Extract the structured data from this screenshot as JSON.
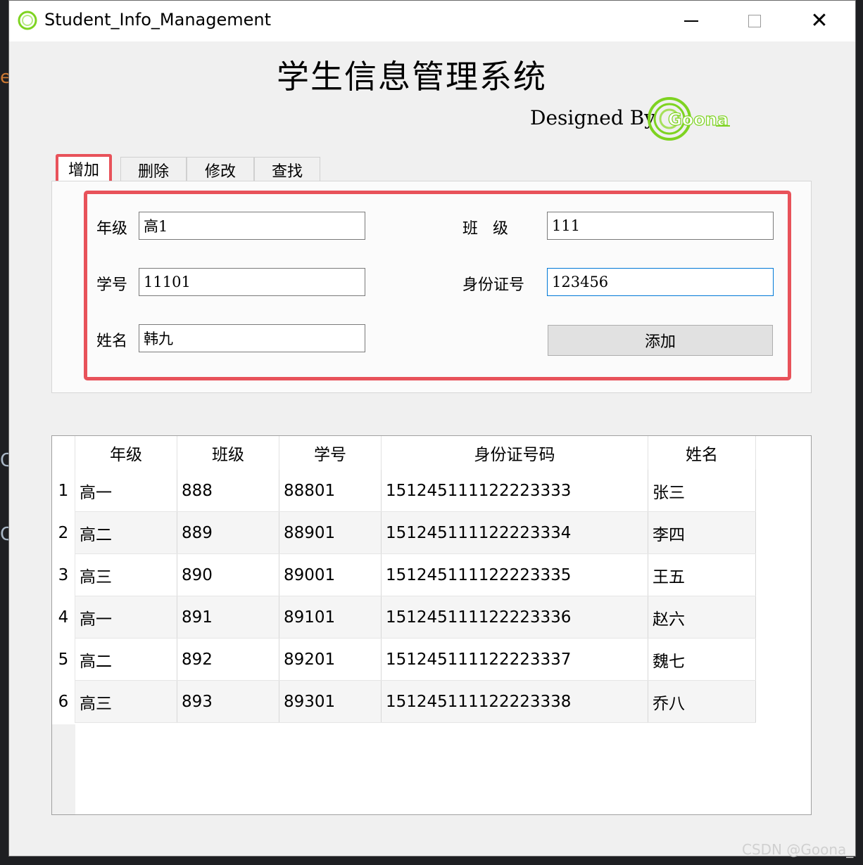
{
  "window": {
    "title": "Student_Info_Management",
    "close_glyph": "✕"
  },
  "header": {
    "title": "学生信息管理系统",
    "designed_by": "Designed By",
    "logo_text": "Goona"
  },
  "tabs": [
    {
      "label": "增加",
      "active": true
    },
    {
      "label": "删除"
    },
    {
      "label": "修改"
    },
    {
      "label": "查找"
    }
  ],
  "form": {
    "grade_label": "年级",
    "grade_value": "高1",
    "class_label": "班   级",
    "class_value": "111",
    "student_id_label": "学号",
    "student_id_value": "11101",
    "id_card_label": "身份证号",
    "id_card_value": "123456",
    "name_label": "姓名",
    "name_value": "韩九",
    "add_button": "添加"
  },
  "table": {
    "headers": [
      "年级",
      "班级",
      "学号",
      "身份证号码",
      "姓名"
    ],
    "rows": [
      {
        "num": "1",
        "grade": "高一",
        "class": "888",
        "sid": "88801",
        "idcard": "151245111122223333",
        "name": "张三"
      },
      {
        "num": "2",
        "grade": "高二",
        "class": "889",
        "sid": "88901",
        "idcard": "151245111122223334",
        "name": "李四"
      },
      {
        "num": "3",
        "grade": "高三",
        "class": "890",
        "sid": "89001",
        "idcard": "151245111122223335",
        "name": "王五"
      },
      {
        "num": "4",
        "grade": "高一",
        "class": "891",
        "sid": "89101",
        "idcard": "151245111122223336",
        "name": "赵六"
      },
      {
        "num": "5",
        "grade": "高二",
        "class": "892",
        "sid": "89201",
        "idcard": "151245111122223337",
        "name": "魏七"
      },
      {
        "num": "6",
        "grade": "高三",
        "class": "893",
        "sid": "89301",
        "idcard": "151245111122223338",
        "name": "乔八"
      }
    ]
  },
  "watermark": "CSDN @Goona_",
  "colors": {
    "highlight": "#e8525a",
    "logo_green": "#7ed321",
    "focus_blue": "#0078d7"
  }
}
